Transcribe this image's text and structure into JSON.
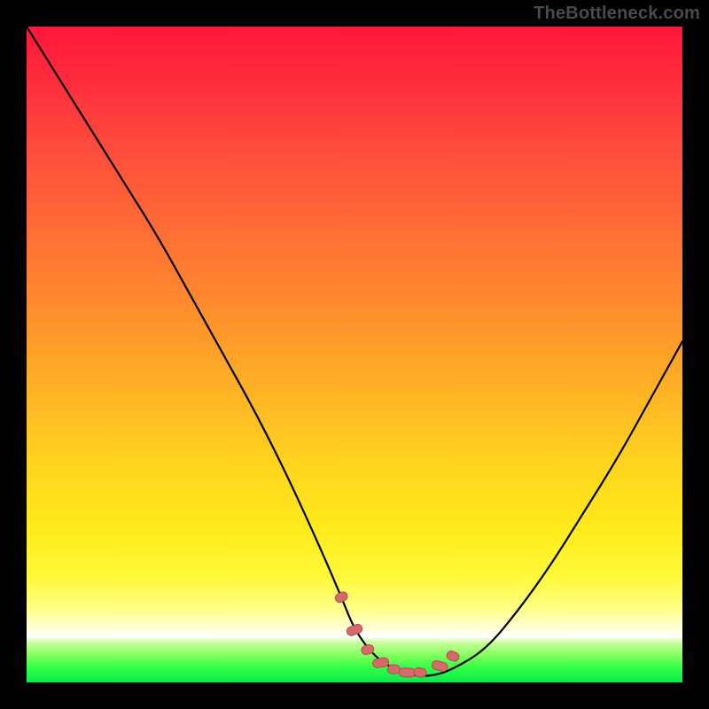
{
  "watermark": "TheBottleneck.com",
  "chart_data": {
    "type": "line",
    "title": "",
    "xlabel": "",
    "ylabel": "",
    "xlim": [
      0,
      100
    ],
    "ylim": [
      0,
      100
    ],
    "series": [
      {
        "name": "bottleneck-curve",
        "x": [
          0,
          5,
          10,
          15,
          20,
          25,
          30,
          35,
          40,
          45,
          48,
          50,
          53,
          56,
          59,
          62,
          65,
          70,
          75,
          80,
          85,
          90,
          95,
          100
        ],
        "y": [
          100,
          92,
          84,
          76,
          68,
          59,
          50,
          41,
          31,
          20,
          13,
          8,
          4,
          2,
          1,
          1,
          2,
          5,
          11,
          18,
          26,
          34,
          43,
          52
        ]
      }
    ],
    "markers": {
      "name": "minimum-region-markers",
      "x": [
        48,
        50,
        52,
        54,
        56,
        58,
        60,
        63,
        65
      ],
      "y": [
        13,
        8,
        5,
        3,
        2,
        1.5,
        1.5,
        2.5,
        4
      ]
    },
    "gradient_background": {
      "type": "vertical",
      "stops": [
        {
          "pos": 0.0,
          "color": "#ff1739"
        },
        {
          "pos": 0.3,
          "color": "#ff6a36"
        },
        {
          "pos": 0.66,
          "color": "#ffd21f"
        },
        {
          "pos": 0.92,
          "color": "#ffffe0"
        },
        {
          "pos": 0.93,
          "color": "#ffffff"
        },
        {
          "pos": 0.96,
          "color": "#7dff5a"
        },
        {
          "pos": 1.0,
          "color": "#0be84a"
        }
      ]
    }
  }
}
